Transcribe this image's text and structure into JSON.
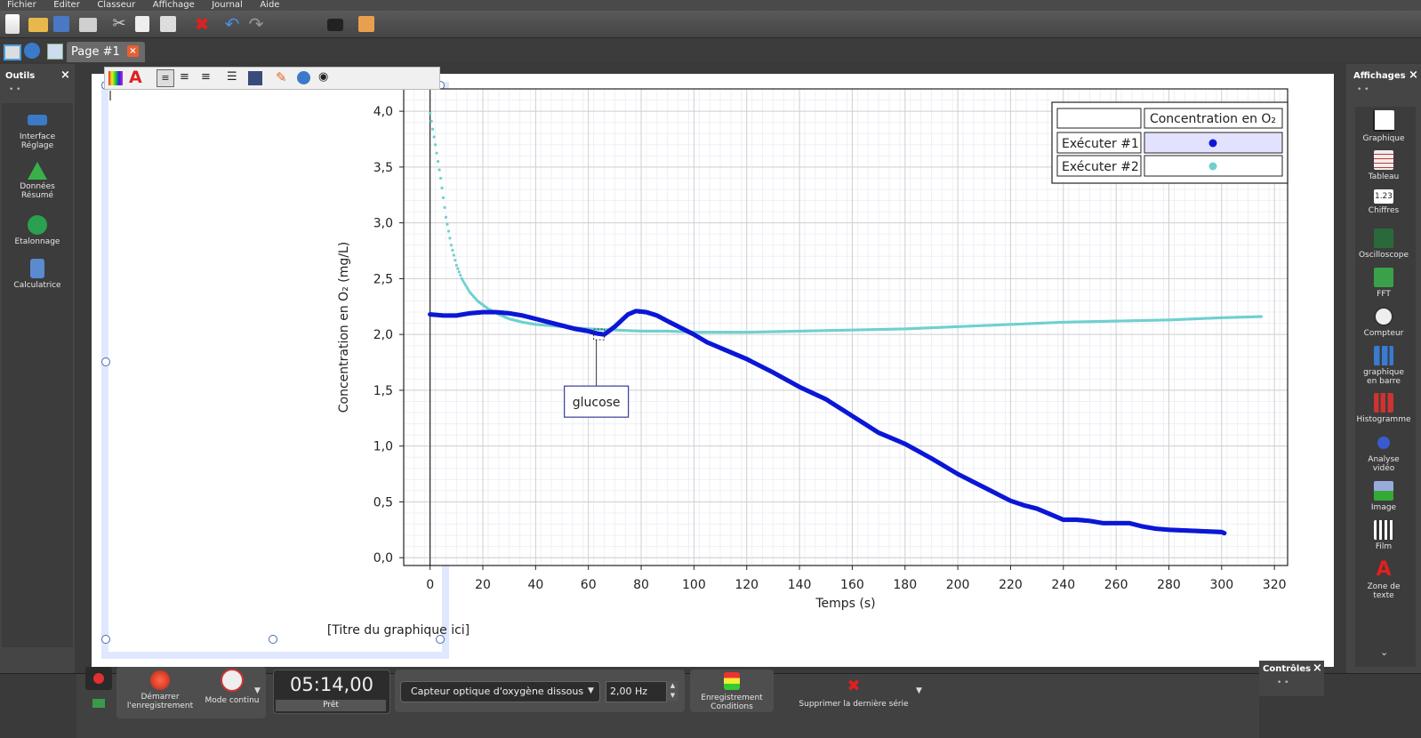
{
  "menu": [
    "Fichier",
    "Editer",
    "Classeur",
    "Affichage",
    "Journal",
    "Aide"
  ],
  "tab": {
    "label": "Page  #1"
  },
  "left_panel": {
    "title": "Outils",
    "items": [
      {
        "label": "Interface\nRéglage",
        "icon": "interface-icon"
      },
      {
        "label": "Données\nRésumé",
        "icon": "data-summary-icon"
      },
      {
        "label": "Etalonnage",
        "icon": "calibration-icon"
      },
      {
        "label": "Calculatrice",
        "icon": "calculator-icon"
      }
    ]
  },
  "right_panel": {
    "title": "Affichages",
    "items": [
      {
        "label": "Graphique",
        "icon": "graph-icon"
      },
      {
        "label": "Tableau",
        "icon": "table-icon"
      },
      {
        "label": "Chiffres",
        "icon": "digits-icon"
      },
      {
        "label": "Oscilloscope",
        "icon": "oscilloscope-icon"
      },
      {
        "label": "FFT",
        "icon": "fft-icon"
      },
      {
        "label": "Compteur",
        "icon": "meter-icon"
      },
      {
        "label": "graphique\nen barre",
        "icon": "bar-graph-icon"
      },
      {
        "label": "Histogramme",
        "icon": "histogram-icon"
      },
      {
        "label": "Analyse\nvidéo",
        "icon": "video-analysis-icon"
      },
      {
        "label": "Image",
        "icon": "image-icon"
      },
      {
        "label": "Film",
        "icon": "film-icon"
      },
      {
        "label": "Zone de\ntexte",
        "icon": "textbox-icon"
      }
    ]
  },
  "bottom": {
    "start_label": "Démarrer\nl'enregistrement",
    "mode_label": "Mode continu",
    "timer": "05:14,00",
    "status": "Prêt",
    "sensor": "Capteur optique d'oxygène dissous",
    "rate": "2,00 Hz",
    "conditions_label": "Enregistrement\nConditions",
    "delete_label": "Supprimer la dernière série",
    "controls_title": "Contrôles"
  },
  "chart_data": {
    "type": "scatter",
    "title": "[Titre du graphique ici]",
    "xlabel": "Temps (s)",
    "ylabel": "Concentration en O₂ (mg/L)",
    "xlim": [
      -10,
      325
    ],
    "ylim": [
      -0.07,
      4.2
    ],
    "xticks": [
      0,
      20,
      40,
      60,
      80,
      100,
      120,
      140,
      160,
      180,
      200,
      220,
      240,
      260,
      280,
      300,
      320
    ],
    "yticks": [
      "0,0",
      "0,5",
      "1,0",
      "1,5",
      "2,0",
      "2,5",
      "3,0",
      "3,5",
      "4,0"
    ],
    "yticks_values": [
      0,
      0.5,
      1,
      1.5,
      2,
      2.5,
      3,
      3.5,
      4
    ],
    "legend": {
      "header": "Concentration en O₂",
      "rows": [
        "Exécuter  #1",
        "Exécuter  #2"
      ]
    },
    "annotation": {
      "text": "glucose",
      "x": 62,
      "y": 2.0
    },
    "series": [
      {
        "name": "Exécuter  #1",
        "color": "#0b17d6",
        "x": [
          0,
          5,
          10,
          15,
          20,
          25,
          30,
          35,
          40,
          45,
          50,
          55,
          60,
          63,
          66,
          70,
          75,
          78,
          82,
          86,
          90,
          95,
          100,
          105,
          110,
          120,
          130,
          140,
          150,
          160,
          170,
          180,
          190,
          200,
          210,
          220,
          225,
          230,
          235,
          240,
          245,
          250,
          255,
          260,
          265,
          270,
          275,
          280,
          290,
          300,
          301
        ],
        "y": [
          2.18,
          2.17,
          2.17,
          2.19,
          2.2,
          2.2,
          2.19,
          2.17,
          2.14,
          2.11,
          2.08,
          2.05,
          2.03,
          2.01,
          2.0,
          2.07,
          2.18,
          2.21,
          2.2,
          2.17,
          2.12,
          2.06,
          2.0,
          1.93,
          1.88,
          1.78,
          1.66,
          1.53,
          1.42,
          1.27,
          1.12,
          1.02,
          0.89,
          0.75,
          0.63,
          0.51,
          0.47,
          0.44,
          0.39,
          0.34,
          0.34,
          0.33,
          0.31,
          0.31,
          0.31,
          0.28,
          0.26,
          0.25,
          0.24,
          0.23,
          0.22
        ]
      },
      {
        "name": "Exécuter  #2",
        "color": "#6fd0cf",
        "x": [
          0,
          2,
          4,
          6,
          8,
          10,
          12,
          15,
          18,
          22,
          26,
          30,
          35,
          40,
          50,
          60,
          70,
          80,
          90,
          100,
          120,
          140,
          160,
          180,
          200,
          220,
          240,
          260,
          280,
          300,
          315
        ],
        "y": [
          3.98,
          3.7,
          3.4,
          3.05,
          2.8,
          2.62,
          2.5,
          2.38,
          2.3,
          2.23,
          2.18,
          2.14,
          2.11,
          2.09,
          2.07,
          2.05,
          2.04,
          2.03,
          2.03,
          2.02,
          2.02,
          2.03,
          2.04,
          2.05,
          2.07,
          2.09,
          2.11,
          2.12,
          2.13,
          2.15,
          2.16
        ]
      }
    ]
  }
}
